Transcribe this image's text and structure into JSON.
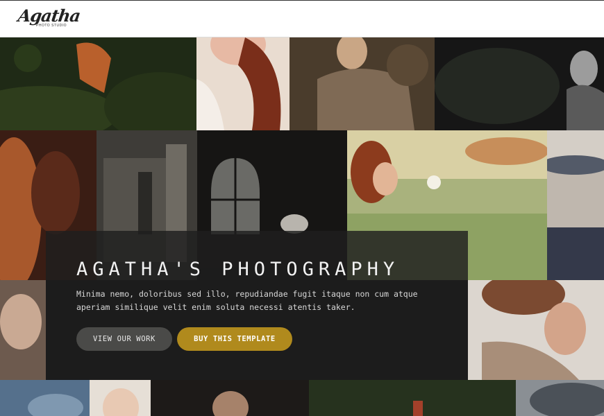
{
  "header": {
    "logo_script": "Agatha",
    "logo_sub": "PHOTO STUDIO"
  },
  "hero": {
    "title": "AGATHA'S PHOTOGRAPHY",
    "description_line1": "Minima nemo, doloribus sed illo, repudiandae fugit itaque non cum atque",
    "description_line2": "aperiam similique velit enim soluta necessi atentis taker.",
    "view_button": "VIEW OUR WORK",
    "buy_button": "BUY THIS TEMPLATE"
  },
  "colors": {
    "accent": "#b08a1d",
    "secondary_button": "#4a4a48",
    "overlay": "#1e1e1e"
  }
}
